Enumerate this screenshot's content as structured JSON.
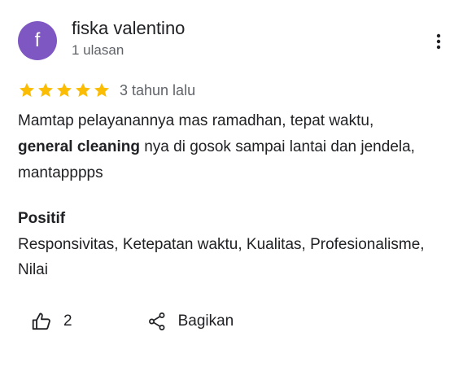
{
  "review": {
    "avatar_letter": "f",
    "avatar_color": "#7e57c2",
    "author_name": "fiska valentino",
    "author_reviews": "1 ulasan",
    "rating": 5,
    "rating_max": 5,
    "star_color": "#fbbc04",
    "time_ago": "3 tahun lalu",
    "body_part1": "Mamtap pelayanannya mas ramadhan, tepat waktu,",
    "body_bold": "general cleaning",
    "body_part2": " nya di gosok sampai lantai dan jendela, mantapppps",
    "positive_title": "Positif",
    "positive_text": "Responsivitas, Ketepatan waktu, Kualitas, Profesionalisme, Nilai"
  },
  "actions": {
    "like_count": "2",
    "share_label": "Bagikan"
  },
  "icons": {
    "more": "more-vert-icon",
    "like": "thumb-up-icon",
    "share": "share-icon"
  }
}
